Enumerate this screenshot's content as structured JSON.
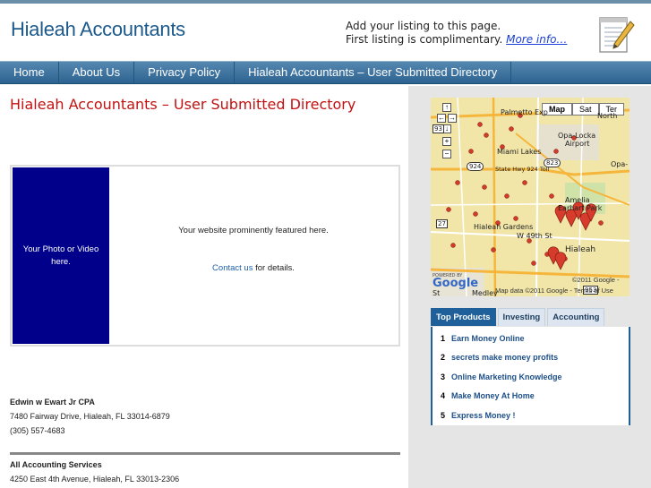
{
  "header": {
    "site_title": "Hialeah Accountants",
    "promo_line1": "Add your listing to this page.",
    "promo_line2": "First listing is complimentary.",
    "promo_link": "More info…"
  },
  "nav": {
    "items": [
      "Home",
      "About Us",
      "Privacy Policy",
      "Hialeah Accountants – User Submitted Directory"
    ]
  },
  "main": {
    "title": "Hialeah Accountants – User Submitted Directory",
    "photo_placeholder": "Your Photo or Video here.",
    "feature_text": "Your website prominently featured here.",
    "contact_link": "Contact us",
    "contact_suffix": " for details.",
    "listings": [
      {
        "name": "Edwin w Ewart Jr CPA",
        "address": "7480 Fairway Drive, Hialeah, FL 33014-6879",
        "phone": "(305) 557-4683"
      },
      {
        "name": "All Accounting Services",
        "address": "4250 East 4th Avenue, Hialeah, FL 33013-2306",
        "phone": ""
      }
    ]
  },
  "map": {
    "types": [
      "Map",
      "Sat",
      "Ter"
    ],
    "active_type": "Map",
    "labels": {
      "palmetto": "Palmetto Exp",
      "north": "North",
      "opa_locka": "Opa-Locka",
      "airport": "Airport",
      "miami_lakes": "Miami Lakes",
      "state_hwy": "State Hwy 924 Toll",
      "opa": "Opa-",
      "amelia": "Amelia",
      "earhart": "Earhart Park",
      "hialeah_gardens": "Hialeah Gardens",
      "w49th": "W 49th St",
      "hialeah": "Hialeah",
      "medley": "Medley",
      "st": "St",
      "shield_93": "93",
      "shield_924": "924",
      "shield_823": "823",
      "shield_27": "27",
      "shield_953": "953"
    },
    "copyright": "©2011 Google -",
    "map_data": "Map data ©2011 Google - Terms of Use",
    "powered_by": "POWERED BY",
    "google": "Google"
  },
  "products": {
    "tabs": [
      "Top Products",
      "Investing",
      "Accounting"
    ],
    "active_tab": "Top Products",
    "items": [
      {
        "num": "1",
        "label": "Earn Money Online"
      },
      {
        "num": "2",
        "label": "secrets make money profits"
      },
      {
        "num": "3",
        "label": "Online Marketing Knowledge"
      },
      {
        "num": "4",
        "label": "Make Money At Home"
      },
      {
        "num": "5",
        "label": "Express Money !"
      }
    ]
  },
  "colors": {
    "brand_blue": "#1d5a8c",
    "title_red": "#c21111",
    "nav_blue": "#2d6391",
    "photo_bg": "#00008b"
  }
}
